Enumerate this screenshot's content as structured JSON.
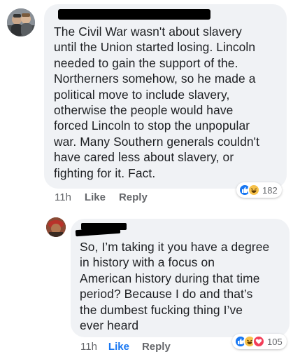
{
  "comments": [
    {
      "text_lines": [
        "The Civil War wasn't about slavery",
        "until the Union started losing. Lincoln",
        "needed to gain the support of the.",
        "Northerners somehow, so he made a",
        "political move to include slavery,",
        "otherwise the people would have",
        "forced Lincoln to stop the unpopular",
        "war. Many Southern generals couldn't",
        "have cared less about slavery, or",
        "fighting for it. Fact."
      ],
      "time": "11h",
      "like_label": "Like",
      "reply_label": "Reply",
      "reactions": [
        "like-icon",
        "haha-icon"
      ],
      "reaction_count": "182"
    },
    {
      "text_lines": [
        "So, I’m taking it you have a degree",
        "in history with a focus on",
        "American history during that time",
        "period? Because I do and that’s",
        "the dumbest fucking thing I’ve",
        "ever heard"
      ],
      "time": "11h",
      "like_label": "Like",
      "reply_label": "Reply",
      "reactions": [
        "like-icon",
        "haha-icon",
        "love-icon"
      ],
      "reaction_count": "105"
    }
  ],
  "colors": {
    "bubble": "#f0f2f5",
    "meta": "#65676b",
    "like_blue": "#1877f2",
    "love_red": "#f33e58",
    "haha_yellow": "#f7c24b"
  }
}
